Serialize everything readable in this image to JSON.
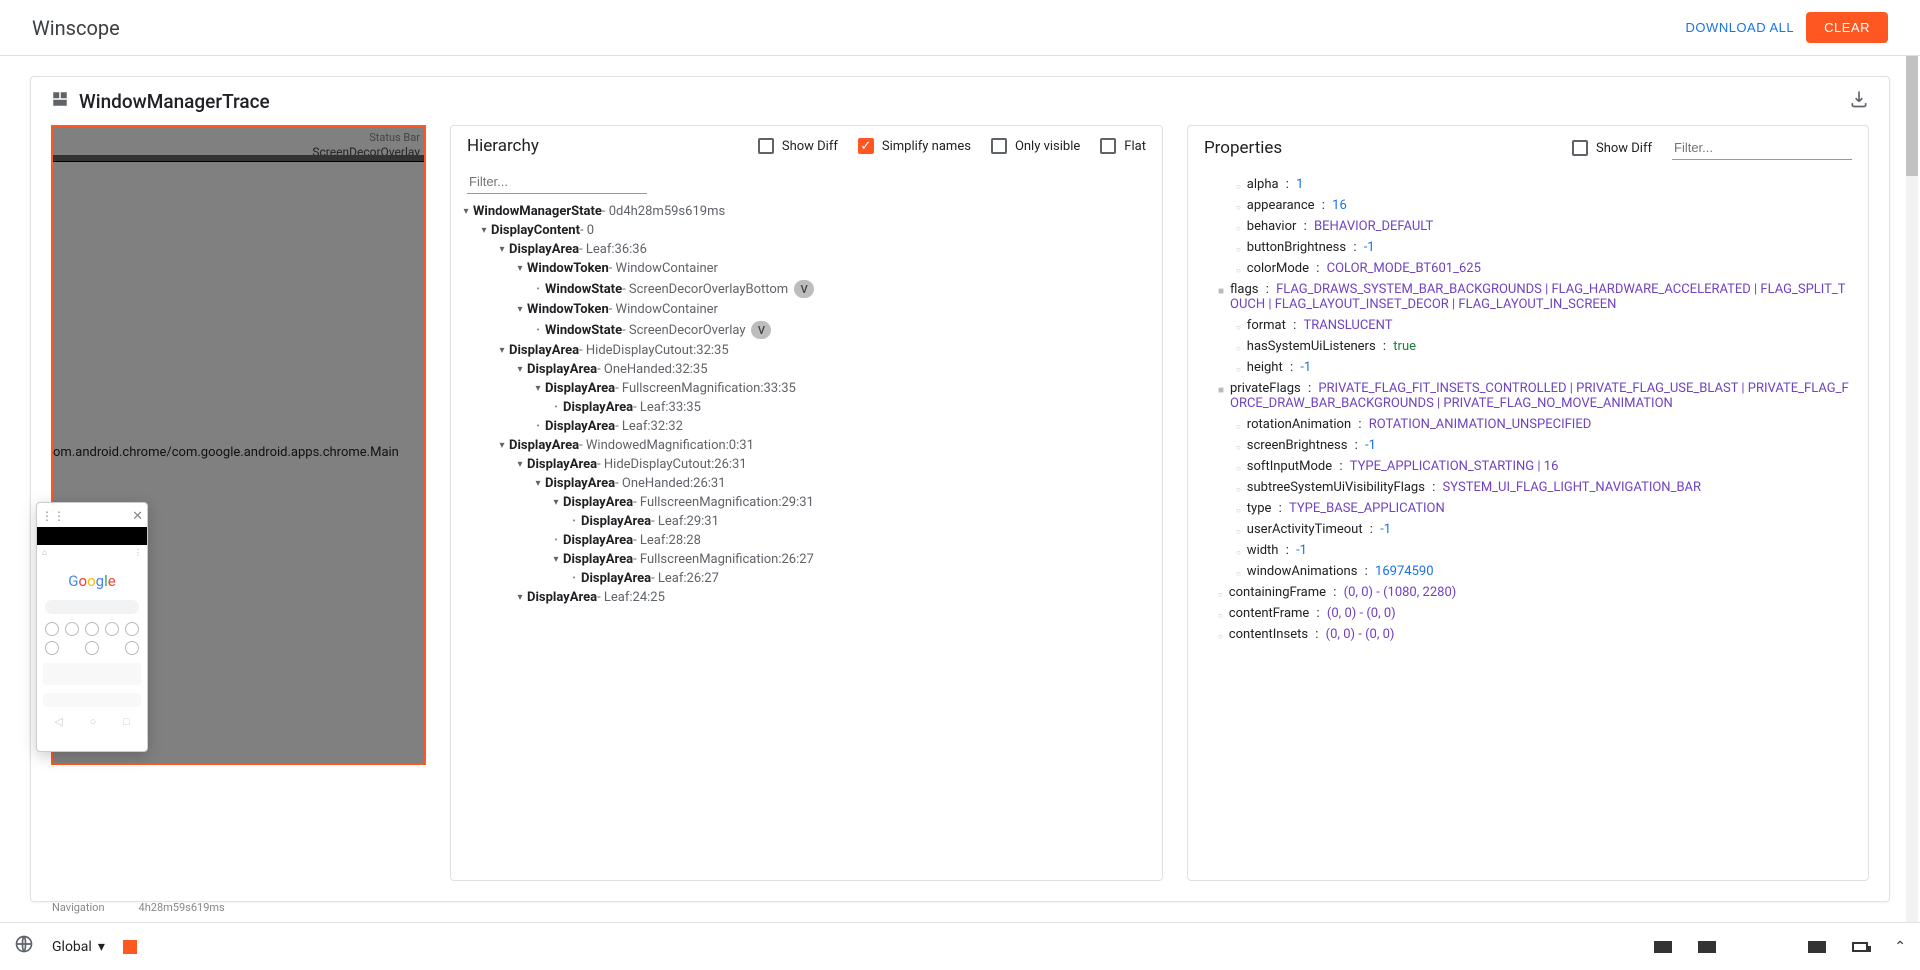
{
  "header": {
    "title": "Winscope",
    "download_all": "DOWNLOAD ALL",
    "clear": "CLEAR"
  },
  "trace_title": "WindowManagerTrace",
  "preview": {
    "top_label1": "Status Bar",
    "overlay": "ScreenDecorOverlay",
    "activity": "om.android.chrome/com.google.android.apps.chrome.Main"
  },
  "hierarchy": {
    "title": "Hierarchy",
    "show_diff": "Show Diff",
    "simplify": "Simplify names",
    "only_visible": "Only visible",
    "flat": "Flat",
    "filter_placeholder": "Filter...",
    "nodes": [
      {
        "indent": 0,
        "toggle": "▾",
        "name": "WindowManagerState",
        "detail": " - 0d4h28m59s619ms"
      },
      {
        "indent": 1,
        "toggle": "▾",
        "name": "DisplayContent",
        "detail": " - 0"
      },
      {
        "indent": 2,
        "toggle": "▾",
        "name": "DisplayArea",
        "detail": " - Leaf:36:36"
      },
      {
        "indent": 3,
        "toggle": "▾",
        "name": "WindowToken",
        "detail": " - WindowContainer"
      },
      {
        "indent": 4,
        "toggle": "•",
        "name": "WindowState",
        "detail": " - ScreenDecorOverlayBottom",
        "badge": "V"
      },
      {
        "indent": 3,
        "toggle": "▾",
        "name": "WindowToken",
        "detail": " - WindowContainer"
      },
      {
        "indent": 4,
        "toggle": "•",
        "name": "WindowState",
        "detail": " - ScreenDecorOverlay",
        "badge": "V"
      },
      {
        "indent": 2,
        "toggle": "▾",
        "name": "DisplayArea",
        "detail": " - HideDisplayCutout:32:35"
      },
      {
        "indent": 3,
        "toggle": "▾",
        "name": "DisplayArea",
        "detail": " - OneHanded:32:35"
      },
      {
        "indent": 4,
        "toggle": "▾",
        "name": "DisplayArea",
        "detail": " - FullscreenMagnification:33:35"
      },
      {
        "indent": 5,
        "toggle": "•",
        "name": "DisplayArea",
        "detail": " - Leaf:33:35"
      },
      {
        "indent": 4,
        "toggle": "•",
        "name": "DisplayArea",
        "detail": " - Leaf:32:32"
      },
      {
        "indent": 2,
        "toggle": "▾",
        "name": "DisplayArea",
        "detail": " - WindowedMagnification:0:31"
      },
      {
        "indent": 3,
        "toggle": "▾",
        "name": "DisplayArea",
        "detail": " - HideDisplayCutout:26:31"
      },
      {
        "indent": 4,
        "toggle": "▾",
        "name": "DisplayArea",
        "detail": " - OneHanded:26:31"
      },
      {
        "indent": 5,
        "toggle": "▾",
        "name": "DisplayArea",
        "detail": " - FullscreenMagnification:29:31"
      },
      {
        "indent": 6,
        "toggle": "•",
        "name": "DisplayArea",
        "detail": " - Leaf:29:31"
      },
      {
        "indent": 5,
        "toggle": "•",
        "name": "DisplayArea",
        "detail": " - Leaf:28:28"
      },
      {
        "indent": 5,
        "toggle": "▾",
        "name": "DisplayArea",
        "detail": " - FullscreenMagnification:26:27"
      },
      {
        "indent": 6,
        "toggle": "•",
        "name": "DisplayArea",
        "detail": " - Leaf:26:27"
      },
      {
        "indent": 3,
        "toggle": "▾",
        "name": "DisplayArea",
        "detail": " - Leaf:24:25"
      }
    ]
  },
  "properties": {
    "title": "Properties",
    "show_diff": "Show Diff",
    "filter_placeholder": "Filter...",
    "items": [
      {
        "indent": 1,
        "bullet": "o",
        "key": "alpha",
        "val": "1",
        "cls": "blue"
      },
      {
        "indent": 1,
        "bullet": "o",
        "key": "appearance",
        "val": "16",
        "cls": "blue"
      },
      {
        "indent": 1,
        "bullet": "o",
        "key": "behavior",
        "val": "BEHAVIOR_DEFAULT",
        "cls": "purple"
      },
      {
        "indent": 1,
        "bullet": "o",
        "key": "buttonBrightness",
        "val": "-1",
        "cls": "blue"
      },
      {
        "indent": 1,
        "bullet": "o",
        "key": "colorMode",
        "val": "COLOR_MODE_BT601_625",
        "cls": "purple"
      },
      {
        "indent": 0,
        "bullet": "s",
        "key": "flags",
        "val": "FLAG_DRAWS_SYSTEM_BAR_BACKGROUNDS | FLAG_HARDWARE_ACCELERATED | FLAG_SPLIT_TOUCH | FLAG_LAYOUT_INSET_DECOR | FLAG_LAYOUT_IN_SCREEN",
        "cls": "purple"
      },
      {
        "indent": 1,
        "bullet": "o",
        "key": "format",
        "val": "TRANSLUCENT",
        "cls": "purple"
      },
      {
        "indent": 1,
        "bullet": "o",
        "key": "hasSystemUiListeners",
        "val": "true",
        "cls": "green"
      },
      {
        "indent": 1,
        "bullet": "o",
        "key": "height",
        "val": "-1",
        "cls": "blue"
      },
      {
        "indent": 0,
        "bullet": "s",
        "key": "privateFlags",
        "val": "PRIVATE_FLAG_FIT_INSETS_CONTROLLED | PRIVATE_FLAG_USE_BLAST | PRIVATE_FLAG_FORCE_DRAW_BAR_BACKGROUNDS | PRIVATE_FLAG_NO_MOVE_ANIMATION",
        "cls": "purple"
      },
      {
        "indent": 1,
        "bullet": "o",
        "key": "rotationAnimation",
        "val": "ROTATION_ANIMATION_UNSPECIFIED",
        "cls": "purple"
      },
      {
        "indent": 1,
        "bullet": "o",
        "key": "screenBrightness",
        "val": "-1",
        "cls": "blue"
      },
      {
        "indent": 1,
        "bullet": "o",
        "key": "softInputMode",
        "val": "TYPE_APPLICATION_STARTING | 16",
        "cls": "purple"
      },
      {
        "indent": 1,
        "bullet": "o",
        "key": "subtreeSystemUiVisibilityFlags",
        "val": "SYSTEM_UI_FLAG_LIGHT_NAVIGATION_BAR",
        "cls": "purple"
      },
      {
        "indent": 1,
        "bullet": "o",
        "key": "type",
        "val": "TYPE_BASE_APPLICATION",
        "cls": "purple"
      },
      {
        "indent": 1,
        "bullet": "o",
        "key": "userActivityTimeout",
        "val": "-1",
        "cls": "blue"
      },
      {
        "indent": 1,
        "bullet": "o",
        "key": "width",
        "val": "-1",
        "cls": "blue"
      },
      {
        "indent": 1,
        "bullet": "o",
        "key": "windowAnimations",
        "val": "16974590",
        "cls": "blue"
      },
      {
        "indent": 0,
        "bullet": "o",
        "key": "containingFrame",
        "val": "(0, 0) - (1080, 2280)",
        "cls": "purple"
      },
      {
        "indent": 0,
        "bullet": "o",
        "key": "contentFrame",
        "val": "(0, 0) - (0, 0)",
        "cls": "purple"
      },
      {
        "indent": 0,
        "bullet": "o",
        "key": "contentInsets",
        "val": "(0, 0) - (0, 0)",
        "cls": "purple"
      }
    ]
  },
  "footer": {
    "nav_label": "Navigation",
    "time_label": "4h28m59s619ms",
    "global": "Global"
  }
}
